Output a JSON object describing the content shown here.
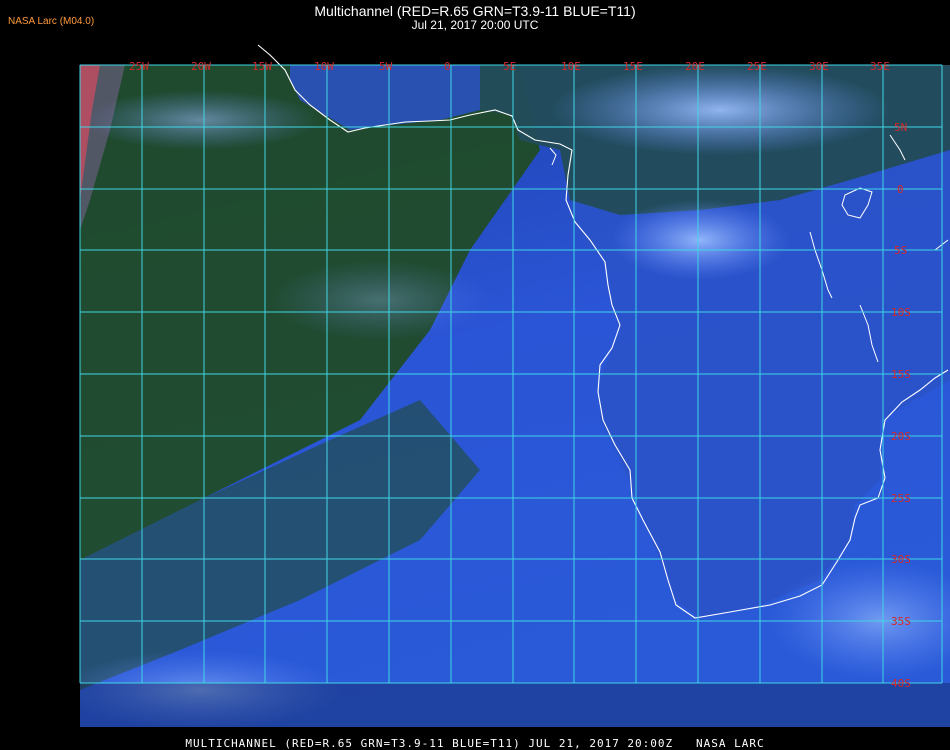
{
  "header": {
    "brand": "NASA Larc (M04.0)",
    "title": "Multichannel (RED=R.65 GRN=T3.9-11 BLUE=T11)",
    "subtitle": "Jul 21, 2017 20:00 UTC"
  },
  "footer": {
    "caption": "MULTICHANNEL (RED=R.65 GRN=T3.9-11 BLUE=T11) JUL 21, 2017 20:00Z   NASA LARC"
  },
  "map": {
    "longitude_labels": [
      "25W",
      "20W",
      "15W",
      "10W",
      "5W",
      "0",
      "5E",
      "10E",
      "15E",
      "20E",
      "25E",
      "30E",
      "35E"
    ],
    "latitude_labels": [
      "5N",
      "0",
      "5S",
      "10S",
      "15S",
      "20S",
      "25S",
      "30S",
      "35S",
      "40S"
    ],
    "colors": {
      "grid": "#3fd6e6",
      "label": "#d42a2a",
      "coastline": "#ffffff",
      "ocean_blue": "#2850d0",
      "land_green": "#1f4a1f",
      "cloud": "#7aa8ff"
    }
  }
}
